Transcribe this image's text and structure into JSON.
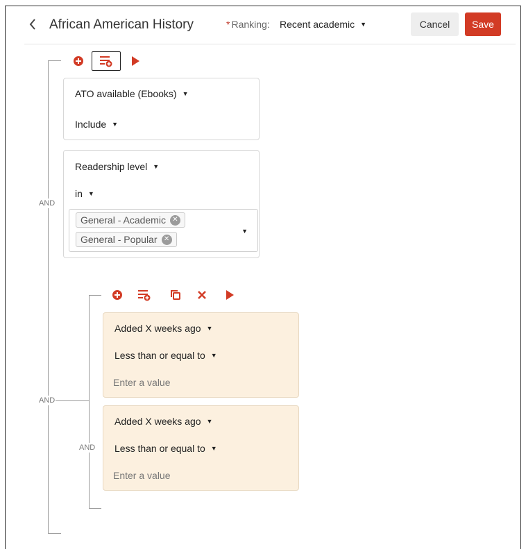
{
  "header": {
    "back_icon": "chevron-left-icon",
    "title": "African American History",
    "ranking_required_mark": "*",
    "ranking_label": "Ranking:",
    "ranking_value": "Recent academic",
    "cancel_label": "Cancel",
    "save_label": "Save"
  },
  "colors": {
    "accent": "#d23b25",
    "card_tan": "#fcf0df",
    "line": "#9a9a9a"
  },
  "outer_group": {
    "operator": "AND",
    "toolbar": [
      "add-circle-icon",
      "add-group-icon",
      "run-play-icon"
    ],
    "conditions": [
      {
        "field": "ATO available (Ebooks)",
        "operator": "Include"
      },
      {
        "field": "Readership level",
        "operator": "in",
        "values": [
          "General - Academic",
          "General - Popular"
        ]
      }
    ]
  },
  "nested_group": {
    "operator": "AND",
    "toolbar": [
      "add-circle-icon",
      "add-group-icon",
      "copy-icon",
      "delete-x-icon",
      "run-play-icon"
    ],
    "conditions": [
      {
        "field": "Added X weeks ago",
        "operator": "Less than or equal to",
        "value_placeholder": "Enter a value"
      },
      {
        "field": "Added X weeks ago",
        "operator": "Less than or equal to",
        "value_placeholder": "Enter a value"
      }
    ]
  }
}
